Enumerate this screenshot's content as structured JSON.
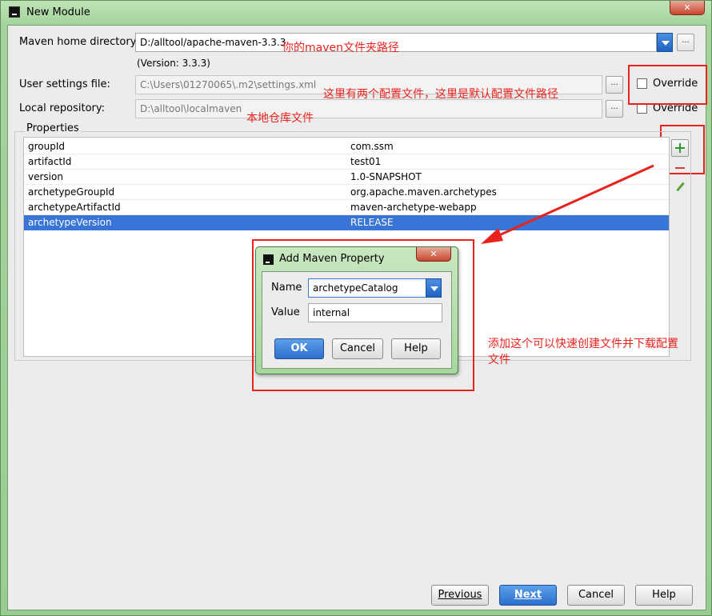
{
  "window": {
    "title": "New Module",
    "close_glyph": "✕"
  },
  "form": {
    "maven_home_label": "Maven home directory:",
    "maven_home_value": "D:/alltool/apache-maven-3.3.3",
    "version": "(Version: 3.3.3)",
    "user_settings_label": "User settings file:",
    "user_settings_value": "C:\\Users\\01270065\\.m2\\settings.xml",
    "local_repo_label": "Local repository:",
    "local_repo_value": "D:\\alltool\\localmaven",
    "override_label": "Override",
    "ellipsis": "..."
  },
  "properties": {
    "legend": "Properties",
    "rows": [
      {
        "key": "groupId",
        "value": "com.ssm"
      },
      {
        "key": "artifactId",
        "value": "test01"
      },
      {
        "key": "version",
        "value": "1.0-SNAPSHOT"
      },
      {
        "key": "archetypeGroupId",
        "value": "org.apache.maven.archetypes"
      },
      {
        "key": "archetypeArtifactId",
        "value": "maven-archetype-webapp"
      },
      {
        "key": "archetypeVersion",
        "value": "RELEASE"
      }
    ],
    "selected_index": 5
  },
  "dialog": {
    "title": "Add Maven Property",
    "close_glyph": "✕",
    "name_label": "Name",
    "name_value": "archetypeCatalog",
    "value_label": "Value",
    "value_value": "internal",
    "ok": "OK",
    "cancel": "Cancel",
    "help": "Help"
  },
  "annotations": {
    "maven_path": "你的maven文件夹路径",
    "config_files": "这里有两个配置文件，这里是默认配置文件路径",
    "local_repo": "本地仓库文件",
    "add_property_line1": "添加这个可以快速创建文件并下载配置",
    "add_property_line2": "文件",
    "color": "#e8231d"
  },
  "footer": {
    "previous": "Previous",
    "next": "Next",
    "cancel": "Cancel",
    "help": "Help"
  }
}
